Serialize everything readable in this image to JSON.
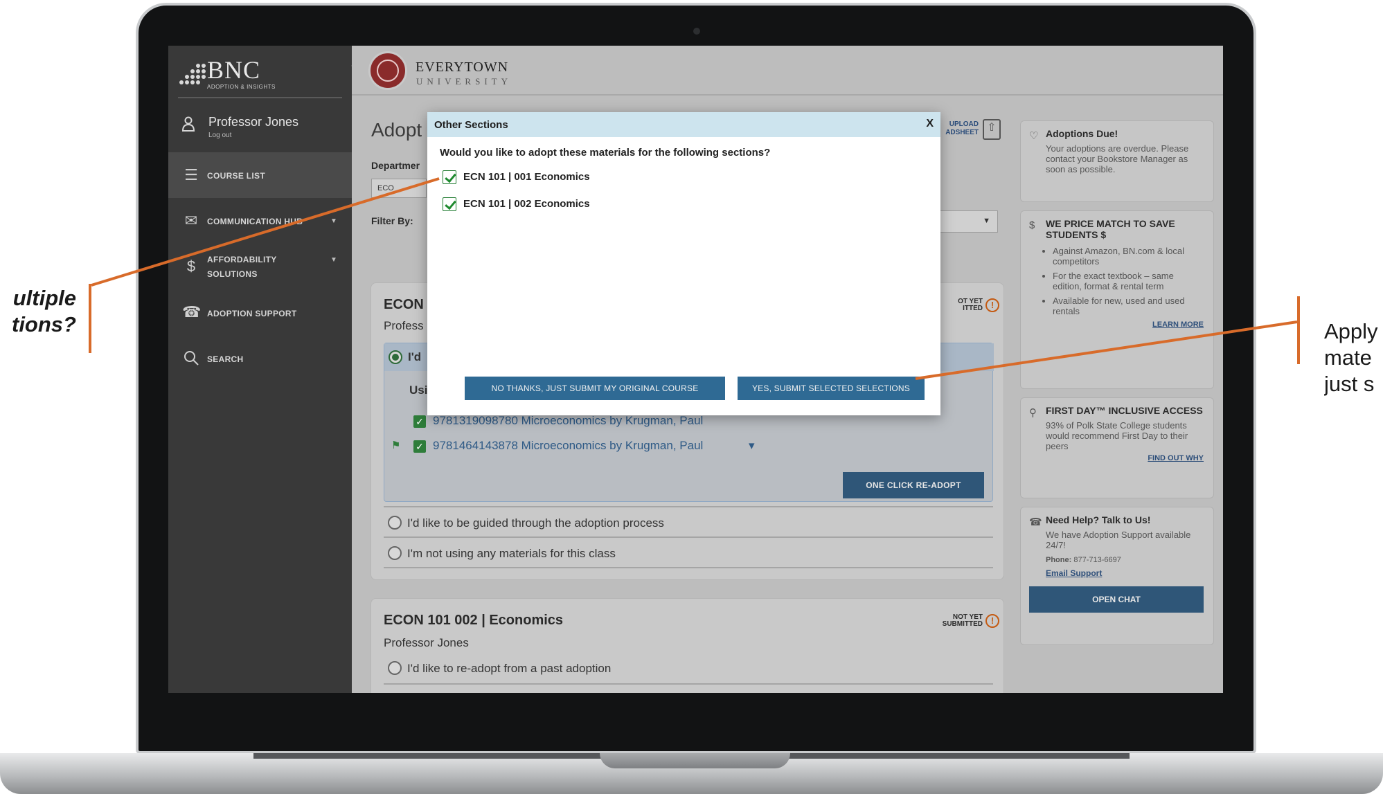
{
  "annotations": {
    "left_line1": "ultiple",
    "left_line2": "tions?",
    "right_line1": "Apply",
    "right_line2": "mate",
    "right_line3": "just s"
  },
  "sidebar": {
    "logo_text": "BNC",
    "logo_sub": "ADOPTION & INSIGHTS",
    "user_name": "Professor Jones",
    "logout": "Log out",
    "items": [
      {
        "label": "COURSE LIST",
        "icon": "clipboard-icon"
      },
      {
        "label": "COMMUNICATION HUB",
        "icon": "chat-icon"
      },
      {
        "label": "AFFORDABILITY",
        "label2": "SOLUTIONS",
        "icon": "dollar-icon"
      },
      {
        "label": "ADOPTION SUPPORT",
        "icon": "phone-icon"
      },
      {
        "label": "SEARCH",
        "icon": "search-icon"
      }
    ]
  },
  "header": {
    "university": "EVERYTOWN",
    "university_sub": "UNIVERSITY"
  },
  "main": {
    "title": "Adopt",
    "department_label": "Departmer",
    "department_value": "ECO",
    "filter_label": "Filter By:",
    "upload_line1": "UPLOAD",
    "upload_line2": "ADSHEET"
  },
  "course1": {
    "title": "ECON",
    "professor": "Profess",
    "status_line1": "OT YET",
    "status_line2": "ITTED",
    "option_head": "I'd",
    "using_label": "Usi",
    "book1": "9781319098780 Microeconomics by Krugman, Paul",
    "book2": "9781464143878 Microeconomics by Krugman, Paul",
    "oneclick": "ONE CLICK RE-ADOPT",
    "guided": "I'd like to be guided through the adoption process",
    "not_using": "I'm not using any materials for this class"
  },
  "course2": {
    "title": "ECON 101 002  | Economics",
    "professor": "Professor Jones",
    "status_line1": "NOT YET",
    "status_line2": "SUBMITTED",
    "readopt": "I'd like to re-adopt from a past adoption"
  },
  "right": {
    "due_title": "Adoptions Due!",
    "due_body": "Your adoptions are overdue. Please contact your Bookstore Manager as soon as possible.",
    "price_title": "WE PRICE MATCH TO SAVE STUDENTS $",
    "price_items": [
      "Against Amazon, BN.com & local competitors",
      "For the exact textbook – same edition, format & rental term",
      "Available for new, used and used rentals"
    ],
    "price_link": "LEARN MORE",
    "firstday_title": "FIRST DAY™ INCLUSIVE ACCESS",
    "firstday_body": "93% of Polk State College students would recommend First Day to their peers",
    "firstday_link": "FIND OUT WHY",
    "help_title": "Need Help? Talk to Us!",
    "help_body": "We have Adoption Support available 24/7!",
    "help_phone_label": "Phone:",
    "help_phone": "877-713-6697",
    "help_email": "Email Support",
    "help_chat": "OPEN CHAT"
  },
  "modal": {
    "title": "Other Sections",
    "close": "X",
    "question": "Would you like to adopt these materials for the following sections?",
    "options": [
      "ECN 101 | 001 Economics",
      "ECN 101 | 002 Economics"
    ],
    "btn_no": "NO THANKS, JUST SUBMIT MY ORIGINAL COURSE",
    "btn_yes": "YES, SUBMIT SELECTED SELECTIONS"
  },
  "colors": {
    "accent": "#d86b2a",
    "button": "#2f6a94",
    "modal_header": "#cde4ee"
  }
}
